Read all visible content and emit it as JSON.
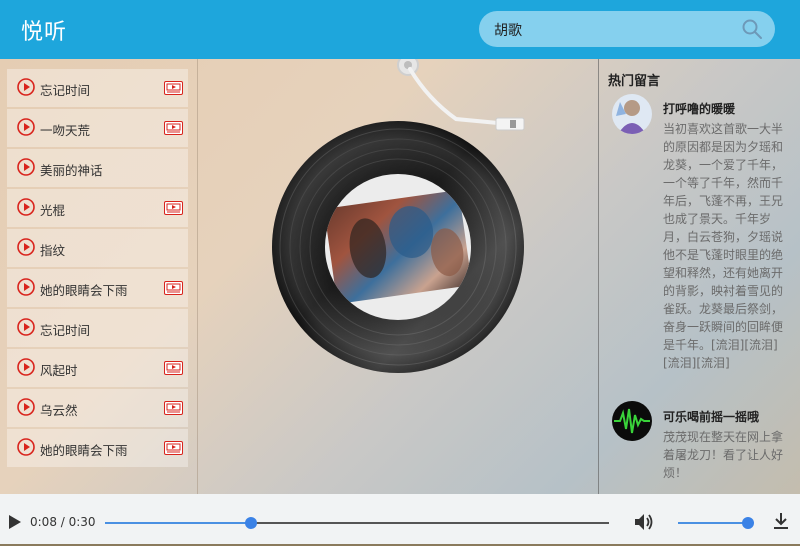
{
  "app": {
    "title": "悦听"
  },
  "search": {
    "value": "胡歌"
  },
  "playlist": {
    "items": [
      {
        "title": "忘记时间",
        "has_mv": true
      },
      {
        "title": "一吻天荒",
        "has_mv": true
      },
      {
        "title": "美丽的神话",
        "has_mv": false
      },
      {
        "title": "光棍",
        "has_mv": true
      },
      {
        "title": "指纹",
        "has_mv": false
      },
      {
        "title": "她的眼睛会下雨",
        "has_mv": true
      },
      {
        "title": "忘记时间",
        "has_mv": false
      },
      {
        "title": "风起时",
        "has_mv": true
      },
      {
        "title": "乌云然",
        "has_mv": true
      },
      {
        "title": "她的眼睛会下雨",
        "has_mv": true
      }
    ]
  },
  "comments": {
    "title": "热门留言",
    "items": [
      {
        "user": "打呼噜的暖暖",
        "text": "当初喜欢这首歌一大半的原因都是因为夕瑶和龙葵，一个爱了千年，一个等了千年，然而千年后，飞蓬不再，王兄也成了景天。千年岁月，白云苍狗，夕瑶说他不是飞蓬时眼里的绝望和释然，还有她离开的背影，映衬着雪见的雀跃。龙葵最后祭剑，奋身一跃瞬间的回眸便是千年。[流泪][流泪][流泪][流泪]"
      },
      {
        "user": "可乐喝前摇一摇哦",
        "text": "茂茂现在整天在网上拿着屠龙刀！看了让人好烦！"
      }
    ]
  },
  "player": {
    "current_time": "0:08",
    "duration": "0:30",
    "time_display": "0:08 / 0:30",
    "progress_fraction": 0.29,
    "volume_fraction": 1.0
  },
  "colors": {
    "header": "#1ea6dc",
    "accent_red": "#d9231c",
    "progress_blue": "#3b82e6"
  }
}
